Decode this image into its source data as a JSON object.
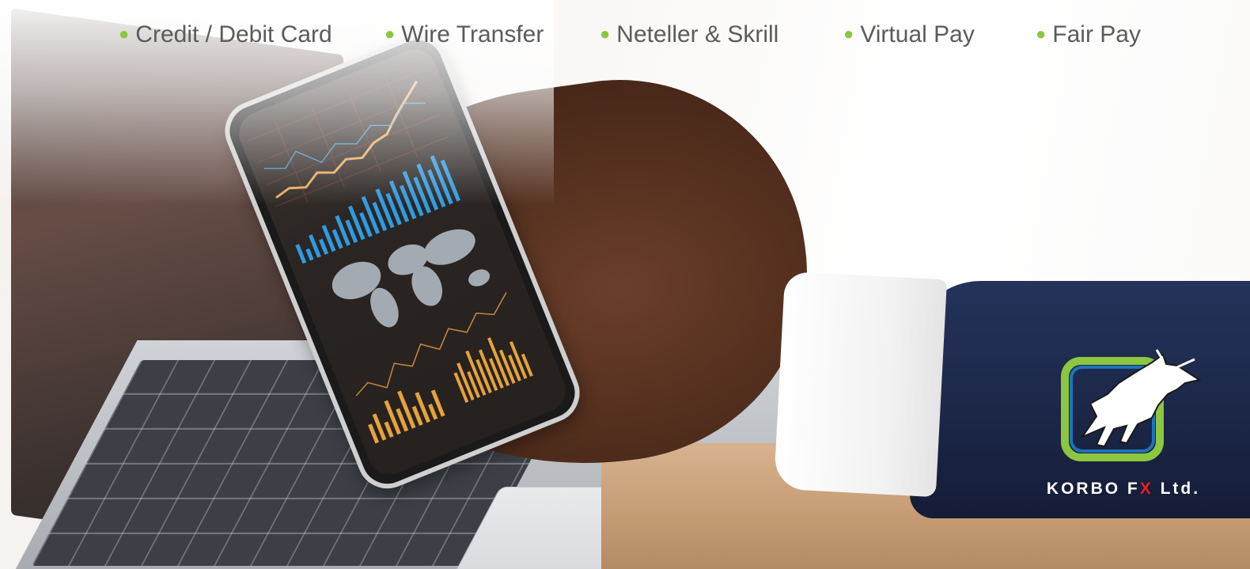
{
  "payment_methods": [
    {
      "label": "Credit / Debit Card"
    },
    {
      "label": "Wire Transfer"
    },
    {
      "label": "Neteller & Skrill"
    },
    {
      "label": "Virtual Pay"
    },
    {
      "label": "Fair Pay"
    }
  ],
  "brand": {
    "name_prefix": "KORBO F",
    "name_x": "X",
    "name_suffix": " Ltd.",
    "logo_icon": "charging-bull-icon"
  },
  "colors": {
    "bullet_green": "#8dc63f",
    "logo_green": "#8dc63f",
    "logo_blue": "#1e73be",
    "brand_red": "#e21f26",
    "method_text": "#5b5b5b"
  }
}
